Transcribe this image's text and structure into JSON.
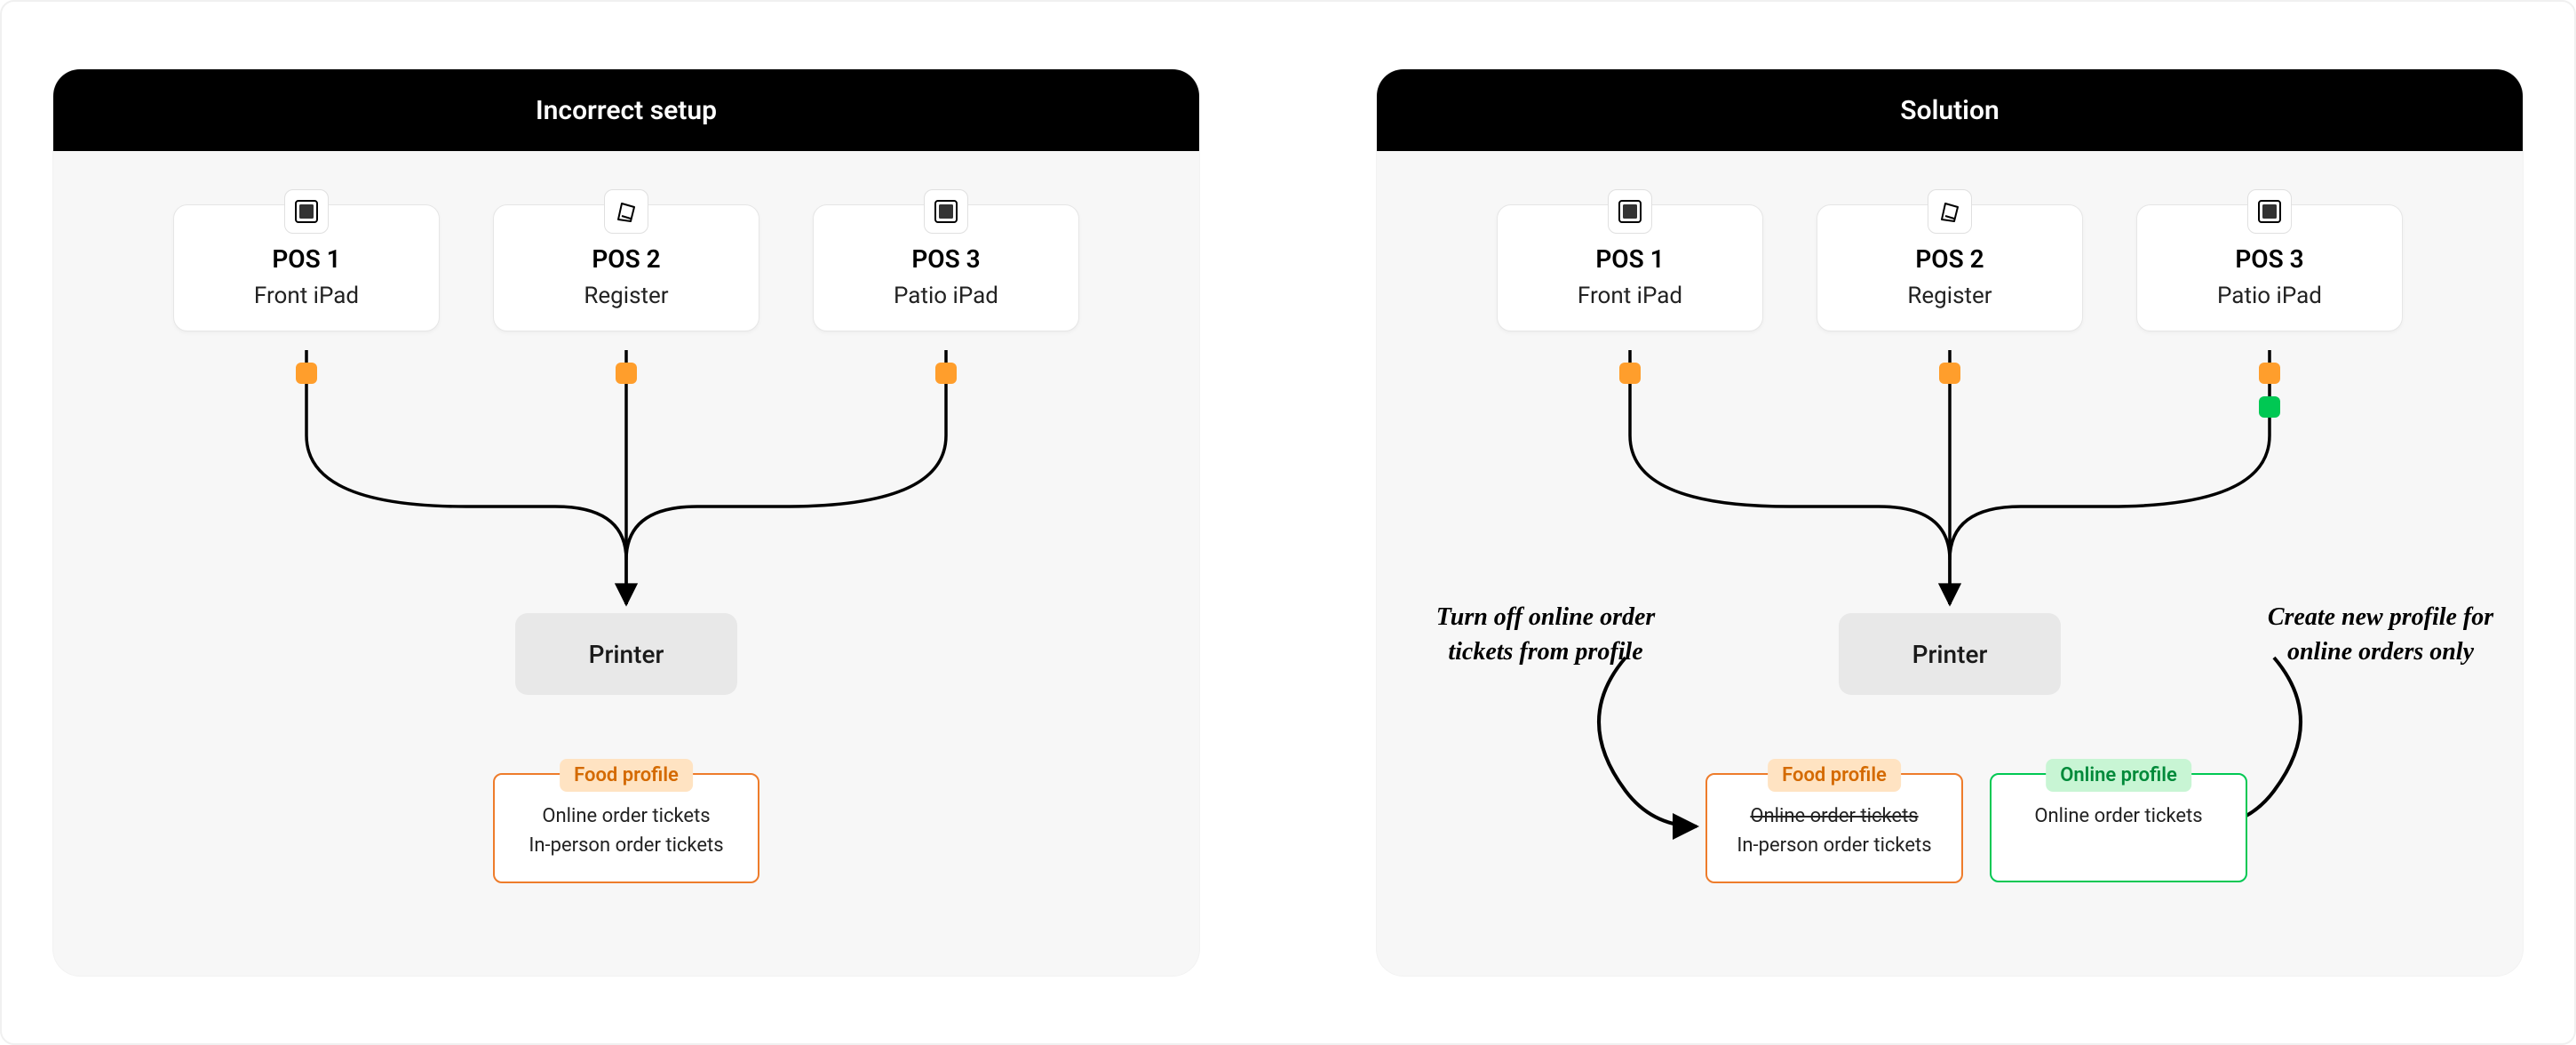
{
  "left": {
    "title": "Incorrect setup",
    "pos": [
      {
        "title": "POS 1",
        "sub": "Front iPad",
        "icon": "tablet"
      },
      {
        "title": "POS 2",
        "sub": "Register",
        "icon": "register"
      },
      {
        "title": "POS 3",
        "sub": "Patio iPad",
        "icon": "tablet"
      }
    ],
    "printer": "Printer",
    "profile": {
      "badge": "Food profile",
      "lines": [
        {
          "text": "Online order tickets",
          "strike": false
        },
        {
          "text": "In-person order tickets",
          "strike": false
        }
      ]
    }
  },
  "right": {
    "title": "Solution",
    "pos": [
      {
        "title": "POS 1",
        "sub": "Front iPad",
        "icon": "tablet"
      },
      {
        "title": "POS 2",
        "sub": "Register",
        "icon": "register"
      },
      {
        "title": "POS 3",
        "sub": "Patio iPad",
        "icon": "tablet"
      }
    ],
    "printer": "Printer",
    "profileFood": {
      "badge": "Food profile",
      "lines": [
        {
          "text": "Online order tickets",
          "strike": true
        },
        {
          "text": "In-person order tickets",
          "strike": false
        }
      ]
    },
    "profileOnline": {
      "badge": "Online profile",
      "lines": [
        {
          "text": "Online order tickets",
          "strike": false
        }
      ]
    },
    "noteLeft": "Turn off online order tickets from profile",
    "noteRight": "Create new profile for online orders only"
  }
}
